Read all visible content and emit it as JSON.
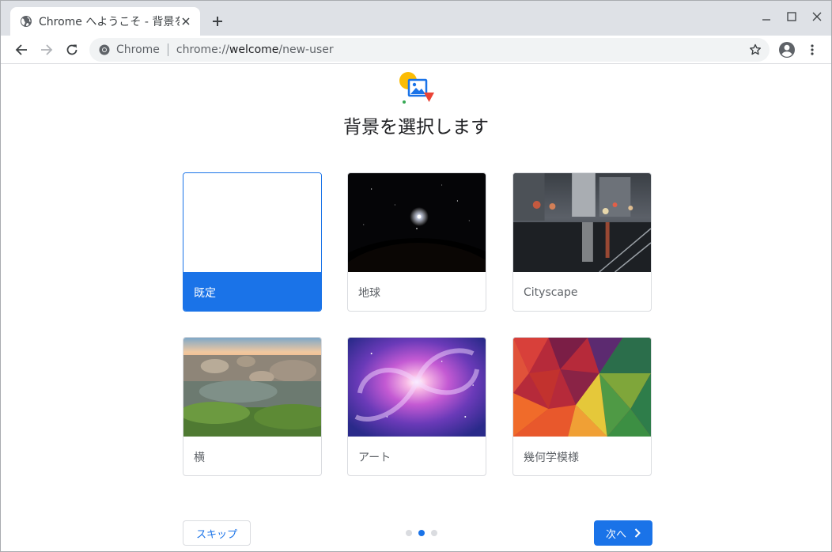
{
  "browser": {
    "tab_title": "Chrome へようこそ - 背景を選択",
    "omnibox": {
      "chip": "Chrome",
      "url_scheme": "chrome://",
      "url_host": "welcome",
      "url_path": "/new-user"
    }
  },
  "page": {
    "title": "背景を選択します",
    "backgrounds": [
      {
        "label": "既定",
        "selected": true
      },
      {
        "label": "地球",
        "selected": false
      },
      {
        "label": "Cityscape",
        "selected": false
      },
      {
        "label": "横",
        "selected": false
      },
      {
        "label": "アート",
        "selected": false
      },
      {
        "label": "幾何学模様",
        "selected": false
      }
    ],
    "skip_label": "スキップ",
    "next_label": "次へ",
    "step_count": 3,
    "current_step": 2
  },
  "colors": {
    "accent": "#1a73e8",
    "tabstrip": "#dee1e6",
    "omnibox": "#f1f3f4",
    "text_secondary": "#5f6368"
  },
  "icons": {
    "favicon": "globe-icon",
    "tab_close": "close-icon",
    "new_tab": "plus-icon",
    "back": "arrow-left-icon",
    "forward": "arrow-right-icon",
    "reload": "reload-icon",
    "bookmark": "star-icon",
    "profile": "account-circle-icon",
    "menu": "more-vert-icon",
    "next": "chevron-right-icon"
  }
}
